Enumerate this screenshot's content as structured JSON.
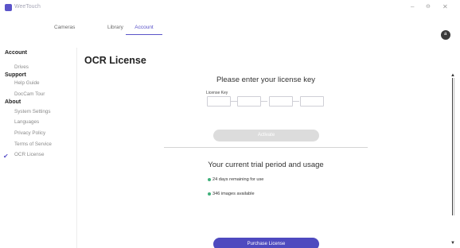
{
  "window": {
    "app_name": "WeeTouch",
    "minimize_glyph": "–",
    "restore_glyph": "⊖",
    "close_glyph": "✕"
  },
  "tabs": [
    {
      "label": "Cameras"
    },
    {
      "label": "Library"
    },
    {
      "label": "Account"
    }
  ],
  "active_tab": "Account",
  "avatar": {
    "initial": "a"
  },
  "sidebar": {
    "sections": [
      {
        "heading": "Account",
        "items": [
          "Drives"
        ]
      },
      {
        "heading": "Support",
        "items": [
          "Help Guide",
          "DocCam Tour"
        ]
      },
      {
        "heading": "About",
        "items": [
          "System Settings",
          "Languages",
          "Privacy Policy",
          "Terms of Service",
          "OCR License"
        ]
      }
    ],
    "active_item": "OCR License",
    "active_marker_icon": "checkmark-icon"
  },
  "main": {
    "title": "OCR License",
    "license_prompt": "Please enter your license key",
    "license_field_label": "License Key",
    "activate_label": "Activate",
    "trial_title": "Your current trial period and usage",
    "usage": [
      "24 days remaining for use",
      "346 images available"
    ],
    "purchase_label": "Purchase License"
  },
  "colors": {
    "accent": "#5b54c9",
    "purchase_button": "#4e4abf",
    "activate_disabled": "#dcdcdc",
    "status_dot": "#3fb07a"
  }
}
